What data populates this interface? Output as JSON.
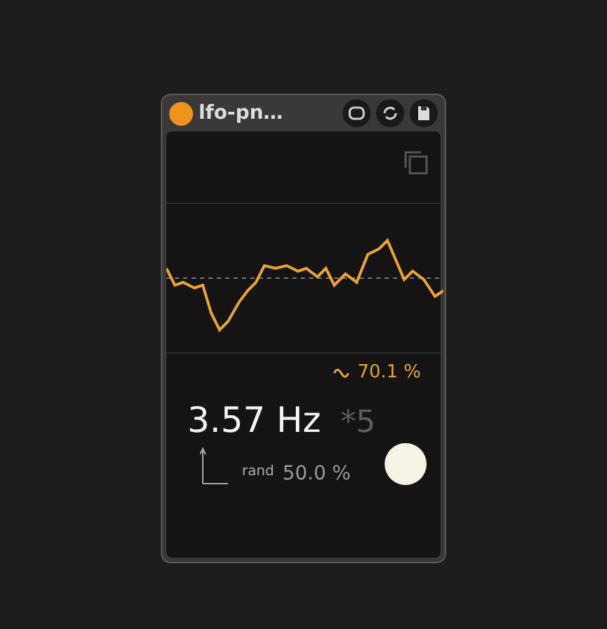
{
  "device": {
    "title": "lfo-pn…",
    "on": true
  },
  "amount": {
    "value": "70.1 %"
  },
  "rate": {
    "value": "3.57 Hz",
    "multiplier": "*5"
  },
  "random": {
    "label": "rand",
    "value": "50.0 %"
  }
}
